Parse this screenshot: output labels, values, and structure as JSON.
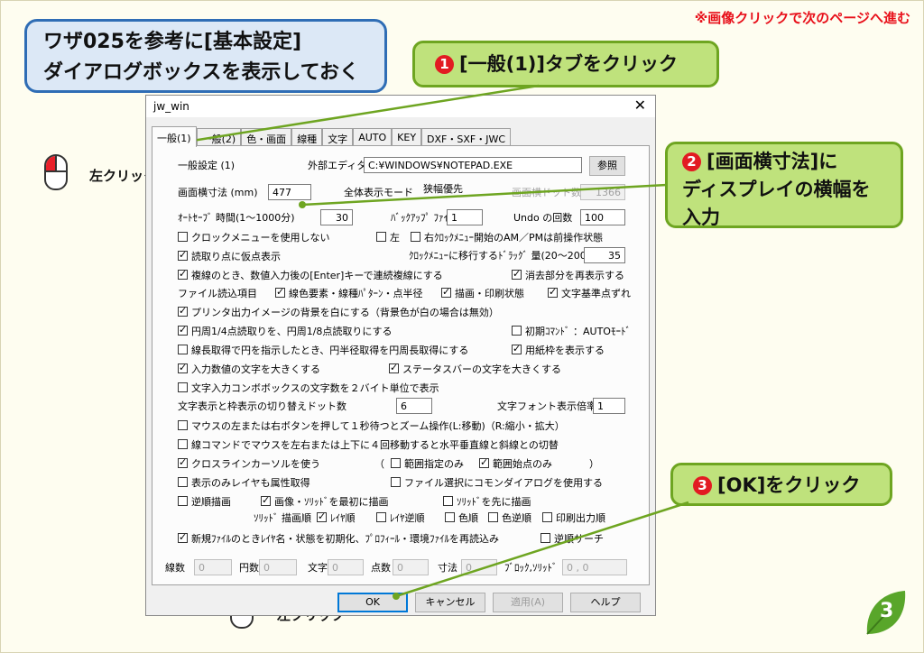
{
  "slide": {
    "nav_hint": "※画像クリックで次のページへ進む",
    "title_line1": "ワザ025を参考に[基本設定]",
    "title_line2": "ダイアログボックスを表示しておく",
    "page_number": "3",
    "callouts": [
      {
        "num": "1",
        "text": "[一般(1)]タブをクリック"
      },
      {
        "num": "2",
        "line1": "[画面横寸法]に",
        "line2": "ディスプレイの横幅を",
        "line3": "入力"
      },
      {
        "num": "3",
        "text": "[OK]をクリック"
      }
    ],
    "mouse_label": "左クリック",
    "colors": {
      "accent_red": "#e21b22",
      "callout_green": "#bfe27c",
      "title_blue": "#2f6db5"
    }
  },
  "dialog": {
    "title": "jw_win",
    "close": "✕",
    "tabs": [
      "一般(1)",
      "一般(2)",
      "色・画面",
      "線種",
      "文字",
      "AUTO",
      "KEY",
      "DXF・SXF・JWC"
    ],
    "section_label": "一般設定 (1)",
    "ext_editor_label": "外部エディタ",
    "ext_editor_value": "C:¥WINDOWS¥NOTEPAD.EXE",
    "browse_button": "参照",
    "screen_width_label": "画面横寸法 (mm)",
    "screen_width_value": "477",
    "display_mode_label": "全体表示モード",
    "display_mode_value": "狭幅優先",
    "screen_dots_label": "画面横ドット数",
    "screen_dots_value": "1366",
    "autosave_label": "ｵｰﾄｾｰﾌﾞ 時間(1～1000分)",
    "autosave_value": "30",
    "backup_label": "ﾊﾞｯｸｱｯﾌﾟ ﾌｧｲﾙ数",
    "backup_value": "1",
    "undo_label": "Undo の回数",
    "undo_value": "100",
    "clock_menu": "クロックメニューを使用しない",
    "left_label": "左",
    "right_clock": "右ｸﾛｯｸﾒﾆｭｰ開始のAM／PMは前操作状態",
    "read_temp_point": "読取り点に仮点表示",
    "clock_drag_label": "ｸﾛｯｸﾒﾆｭｰに移行するﾄﾞﾗｯｸﾞ 量(20～200)",
    "clock_drag_value": "35",
    "double_line": "複線のとき、数値入力後の[Enter]キーで連続複線にする",
    "redisplay_erase": "消去部分を再表示する",
    "file_read_items": "ファイル読込項目",
    "line_color": "線色要素・線種ﾊﾟﾀｰﾝ・点半径",
    "draw_print": "描画・印刷状態",
    "text_base": "文字基準点ずれ",
    "printer_bg": "プリンタ出力イメージの背景を白にする（背景色が白の場合は無効）",
    "circle_quarter": "円周1/4点読取りを、円周1/8点読取りにする",
    "initial_cmd": "初期ｺﾏﾝﾄﾞ ：AUTOﾓｰﾄﾞ",
    "line_length": "線長取得で円を指示したとき、円半径取得を円周長取得にする",
    "paper_frame": "用紙枠を表示する",
    "input_text_large": "入力数値の文字を大きくする",
    "status_bar_large": "ステータスバーの文字を大きくする",
    "combobox_2byte": "文字入力コンボボックスの文字数を２バイト単位で表示",
    "switch_dots_label": "文字表示と枠表示の切り替えドット数",
    "switch_dots_value": "6",
    "font_scale_label": "文字フォント表示倍率",
    "font_scale_value": "1",
    "zoom_mouse": "マウスの左または右ボタンを押して１秒待つとズーム操作(L:移動)（R:縮小・拡大）",
    "line_cmd_mouse": "線コマンドでマウスを左右または上下に４回移動すると水平垂直線と斜線との切替",
    "crosshair": "クロスラインカーソルを使う",
    "range_specified": "範囲指定のみ",
    "range_start": "範囲始点のみ",
    "paren_open": "（",
    "paren_close": "）",
    "layer_attr": "表示のみレイヤも属性取得",
    "common_dialog": "ファイル選択にコモンダイアログを使用する",
    "reverse_draw": "逆順描画",
    "image_solid_first": "画像・ｿﾘｯﾄﾞを最初に描画",
    "solid_first": "ｿﾘｯﾄﾞを先に描画",
    "solid_draw_order": "ｿﾘｯﾄﾞ 描画順",
    "layer_order": "ﾚｲﾔ順",
    "layer_reverse": "ﾚｲﾔ逆順",
    "color_order": "色順",
    "color_reverse": "色逆順",
    "print_order": "印刷出力順",
    "new_file_init": "新規ﾌｧｲﾙのときﾚｲﾔ名・状態を初期化、ﾌﾟﾛﾌｨｰﾙ・環境ﾌｧｲﾙを再読込み",
    "reverse_search": "逆順サーチ",
    "stats": {
      "lines_label": "線数",
      "lines_value": "0",
      "arcs_label": "円数",
      "arcs_value": "0",
      "text_label": "文字",
      "text_value": "0",
      "points_label": "点数",
      "points_value": "0",
      "dims_label": "寸法",
      "dims_value": "0",
      "block_label": "ﾌﾞﾛｯｸ,ｿﾘｯﾄﾞ",
      "block_value": "0 , 0"
    },
    "ok_button": "OK",
    "cancel_button": "キャンセル",
    "apply_button": "適用(A)",
    "help_button": "ヘルプ"
  }
}
